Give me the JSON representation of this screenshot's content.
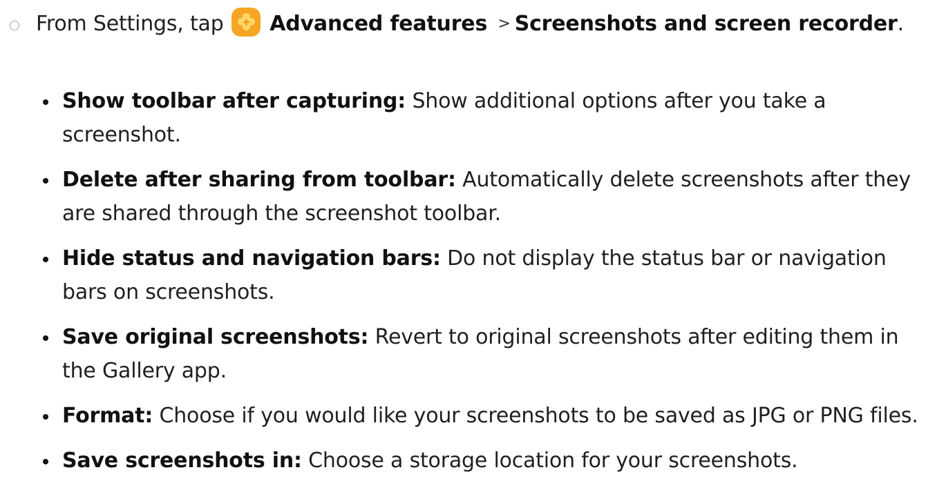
{
  "step": {
    "prefix": "From Settings, tap",
    "icon": "advanced-features-icon",
    "path_1": "Advanced features",
    "separator": ">",
    "path_2": "Screenshots and screen recorder",
    "suffix": "."
  },
  "items": [
    {
      "term": "Show toolbar after capturing",
      "colon": ":",
      "desc": "Show additional options after you take a screenshot."
    },
    {
      "term": "Delete after sharing from toolbar",
      "colon": ":",
      "desc": "Automatically delete screenshots after they are shared through the screenshot toolbar."
    },
    {
      "term": "Hide status and navigation bars",
      "colon": ":",
      "desc": "Do not display the status bar or navigation bars on screenshots."
    },
    {
      "term": "Save original screenshots",
      "colon": ":",
      "desc": "Revert to original screenshots after editing them in the Gallery app."
    },
    {
      "term": "Format",
      "colon": ":",
      "desc": "Choose if you would like your screenshots to be saved as JPG or PNG files."
    },
    {
      "term": "Save screenshots in",
      "colon": ":",
      "desc": "Choose a storage location for your screenshots."
    }
  ],
  "colors": {
    "icon_background": "#f6a524",
    "text": "#1f1f1f"
  }
}
